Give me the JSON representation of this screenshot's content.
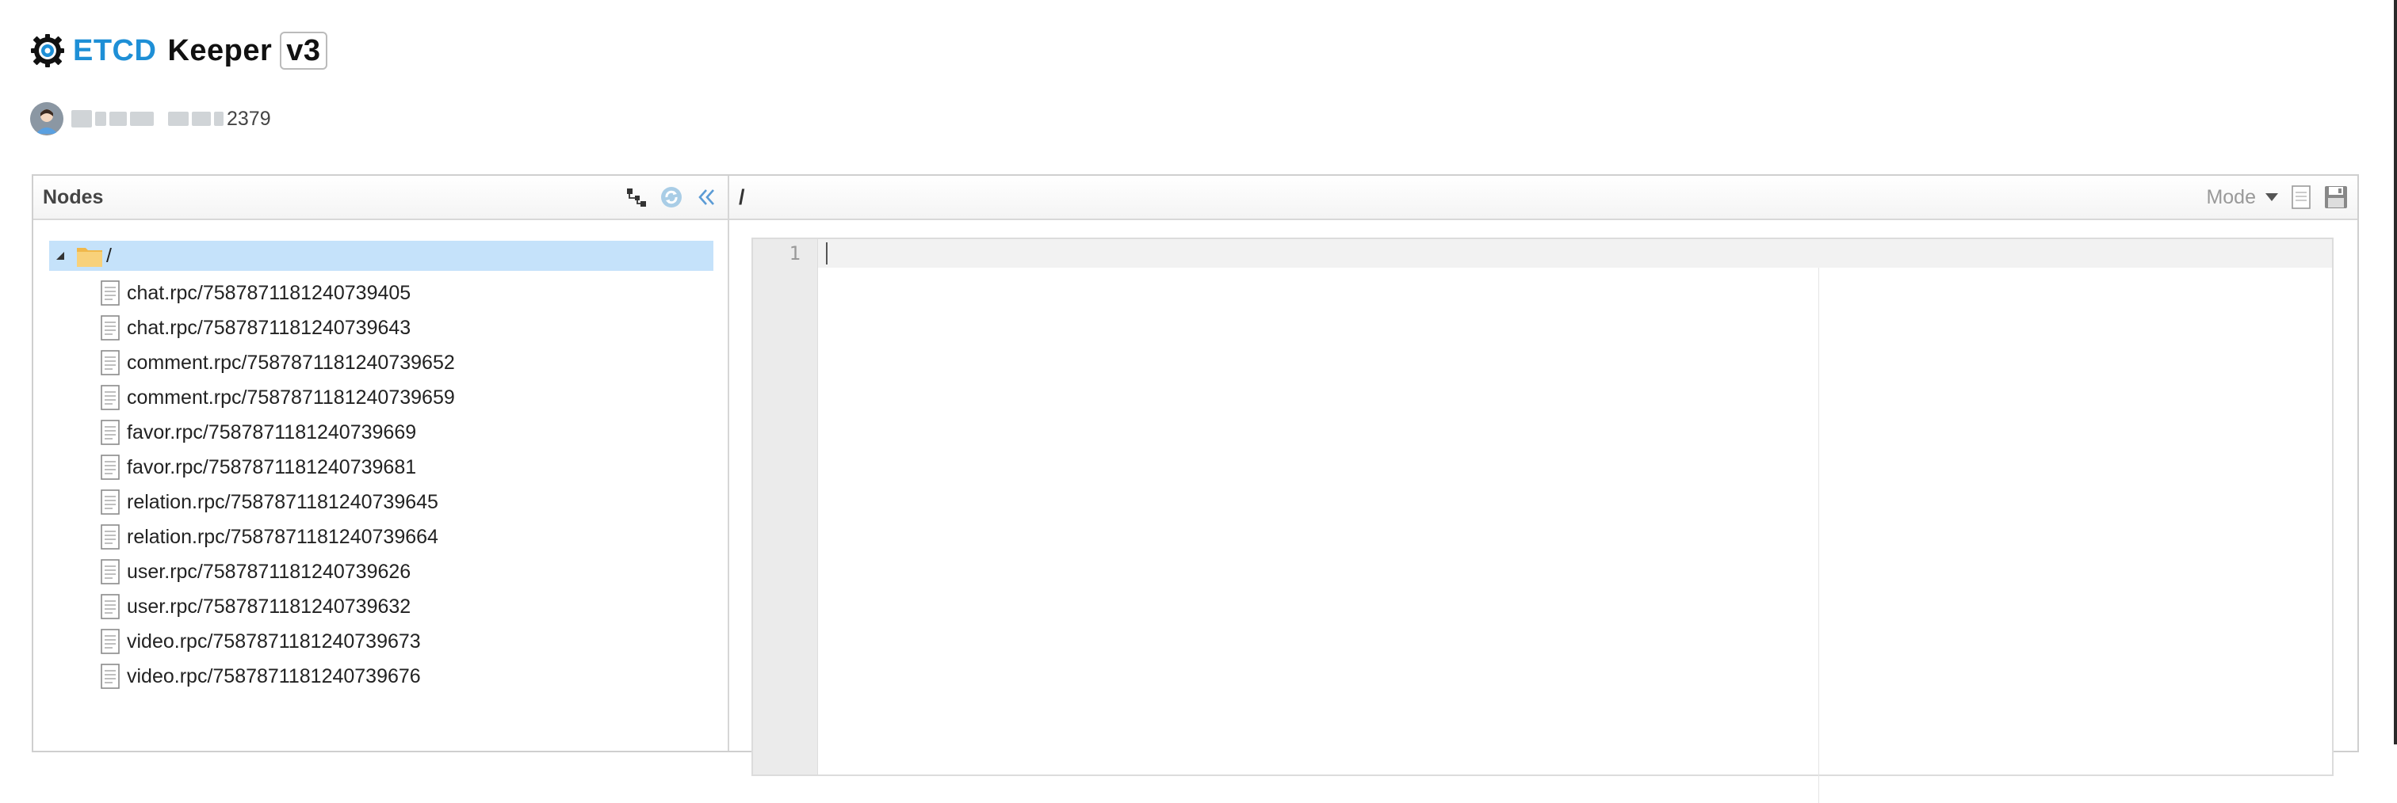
{
  "app": {
    "title_part1": "ETCD",
    "title_part2": "Keeper",
    "version": "v3"
  },
  "connection": {
    "port_suffix": "2379"
  },
  "nodes_panel": {
    "title": "Nodes",
    "tools": [
      "tree-structure-icon",
      "refresh-icon",
      "collapse-left-icon"
    ],
    "root": {
      "label": "/",
      "expanded": true,
      "selected": true
    },
    "items": [
      "chat.rpc/7587871181240739405",
      "chat.rpc/7587871181240739643",
      "comment.rpc/7587871181240739652",
      "comment.rpc/7587871181240739659",
      "favor.rpc/7587871181240739669",
      "favor.rpc/7587871181240739681",
      "relation.rpc/7587871181240739645",
      "relation.rpc/7587871181240739664",
      "user.rpc/7587871181240739626",
      "user.rpc/7587871181240739632",
      "video.rpc/7587871181240739673",
      "video.rpc/7587871181240739676"
    ]
  },
  "editor": {
    "path": "/",
    "mode_label": "Mode",
    "line_numbers": [
      "1"
    ],
    "content": ""
  },
  "colors": {
    "brand_blue": "#1e8fd6",
    "selection": "#c5e2fa"
  }
}
